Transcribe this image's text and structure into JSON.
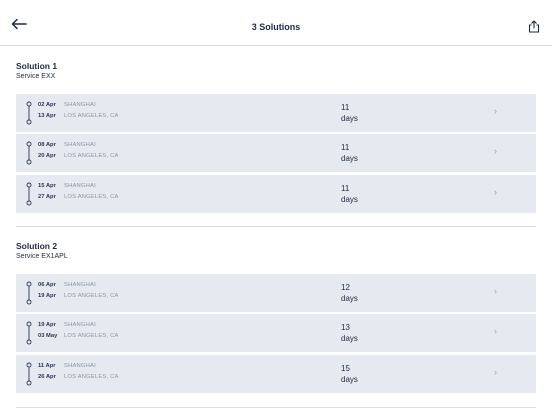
{
  "header": {
    "title": "3 Solutions",
    "back_icon": "arrow-left-icon",
    "share_icon": "share-icon"
  },
  "solutions": [
    {
      "title": "Solution 1",
      "service": "Service EXX",
      "routes": [
        {
          "dep_date": "02 Apr",
          "dep_place": "SHANGHAI",
          "arr_date": "13 Apr",
          "arr_place": "LOS ANGELES, CA",
          "duration": "11",
          "unit": "days"
        },
        {
          "dep_date": "08 Apr",
          "dep_place": "SHANGHAI",
          "arr_date": "20 Apr",
          "arr_place": "LOS ANGELES, CA",
          "duration": "11",
          "unit": "days"
        },
        {
          "dep_date": "15 Apr",
          "dep_place": "SHANGHAI",
          "arr_date": "27 Apr",
          "arr_place": "LOS ANGELES, CA",
          "duration": "11",
          "unit": "days"
        }
      ]
    },
    {
      "title": "Solution 2",
      "service": "Service EX1APL",
      "routes": [
        {
          "dep_date": "06 Apr",
          "dep_place": "SHANGHAI",
          "arr_date": "19 Apr",
          "arr_place": "LOS ANGELES, CA",
          "duration": "12",
          "unit": "days"
        },
        {
          "dep_date": "19 Apr",
          "dep_place": "SHANGHAI",
          "arr_date": "03 May",
          "arr_place": "LOS ANGELES, CA",
          "duration": "13",
          "unit": "days"
        },
        {
          "dep_date": "11 Apr",
          "dep_place": "SHANGHAI",
          "arr_date": "26 Apr",
          "arr_place": "LOS ANGELES, CA",
          "duration": "15",
          "unit": "days"
        }
      ]
    }
  ],
  "chevron": "›"
}
